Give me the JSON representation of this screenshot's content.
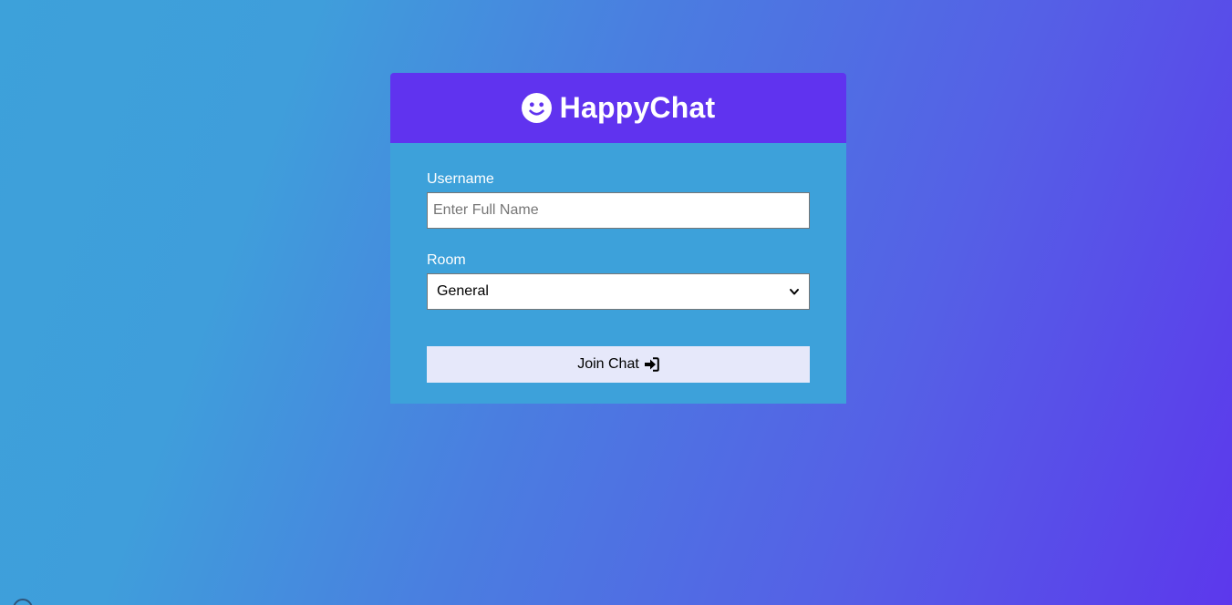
{
  "app": {
    "title": "HappyChat",
    "logo_icon": "smiley-face-icon"
  },
  "form": {
    "username": {
      "label": "Username",
      "placeholder": "Enter Full Name",
      "value": ""
    },
    "room": {
      "label": "Room",
      "selected": "General"
    },
    "join_button": {
      "label": "Join Chat",
      "icon": "sign-in-icon"
    }
  },
  "colors": {
    "header_bg": "#6033ef",
    "body_bg": "#3da1da",
    "button_bg": "#e6e8fa",
    "gradient_start": "#3da1da",
    "gradient_end": "#5c38ec"
  }
}
